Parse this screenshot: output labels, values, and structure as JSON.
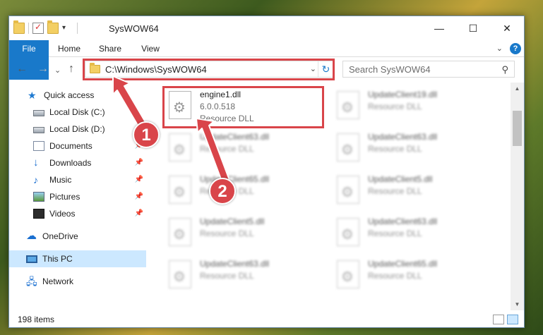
{
  "window": {
    "title": "SysWOW64",
    "controls": {
      "minimize": "—",
      "maximize": "☐",
      "close": "✕"
    }
  },
  "ribbon": {
    "tabs": [
      "File",
      "Home",
      "Share",
      "View"
    ],
    "help": "?",
    "chevron": "⌄"
  },
  "nav": {
    "back": "←",
    "forward": "→",
    "recent": "⌄",
    "up": "↑",
    "address": "C:\\Windows\\SysWOW64",
    "address_dropdown": "⌄",
    "refresh": "↻",
    "search_placeholder": "Search SysWOW64",
    "search_icon": "⚲"
  },
  "sidebar": {
    "items": [
      {
        "label": "Quick access",
        "icon": "star-icon",
        "pinned": false
      },
      {
        "label": "Local Disk (C:)",
        "icon": "disk-icon",
        "pinned": false
      },
      {
        "label": "Local Disk (D:)",
        "icon": "disk-icon",
        "pinned": false
      },
      {
        "label": "Documents",
        "icon": "documents-icon",
        "pinned": true
      },
      {
        "label": "Downloads",
        "icon": "download-icon",
        "pinned": true
      },
      {
        "label": "Music",
        "icon": "music-icon",
        "pinned": true
      },
      {
        "label": "Pictures",
        "icon": "pictures-icon",
        "pinned": true
      },
      {
        "label": "Videos",
        "icon": "videos-icon",
        "pinned": true
      },
      {
        "label": "OneDrive",
        "icon": "cloud-icon",
        "pinned": false
      },
      {
        "label": "This PC",
        "icon": "pc-icon",
        "pinned": false,
        "selected": true
      },
      {
        "label": "Network",
        "icon": "network-icon",
        "pinned": false
      }
    ],
    "pin_glyph": "📌"
  },
  "files": [
    {
      "name": "engine1.dll",
      "version": "6.0.0.518",
      "type": "Resource DLL"
    },
    {
      "name": "UpdateClient19.dll",
      "version": "",
      "type": "Resource DLL"
    },
    {
      "name": "UpdateClient63.dll",
      "version": "",
      "type": "Resource DLL"
    },
    {
      "name": "UpdateClient63.dll",
      "version": "",
      "type": "Resource DLL"
    },
    {
      "name": "UpdateClient65.dll",
      "version": "",
      "type": "Resource DLL"
    },
    {
      "name": "UpdateClient5.dll",
      "version": "",
      "type": "Resource DLL"
    },
    {
      "name": "UpdateClient5.dll",
      "version": "",
      "type": "Resource DLL"
    },
    {
      "name": "UpdateClient63.dll",
      "version": "",
      "type": "Resource DLL"
    },
    {
      "name": "UpdateClient63.dll",
      "version": "",
      "type": "Resource DLL"
    },
    {
      "name": "UpdateClient65.dll",
      "version": "",
      "type": "Resource DLL"
    }
  ],
  "status": {
    "item_count": "198 items"
  },
  "annotations": {
    "badges": [
      "1",
      "2"
    ],
    "color": "#d9454a"
  },
  "colors": {
    "accent": "#1979ca",
    "selection": "#cce8ff",
    "highlight": "#d9454a"
  }
}
